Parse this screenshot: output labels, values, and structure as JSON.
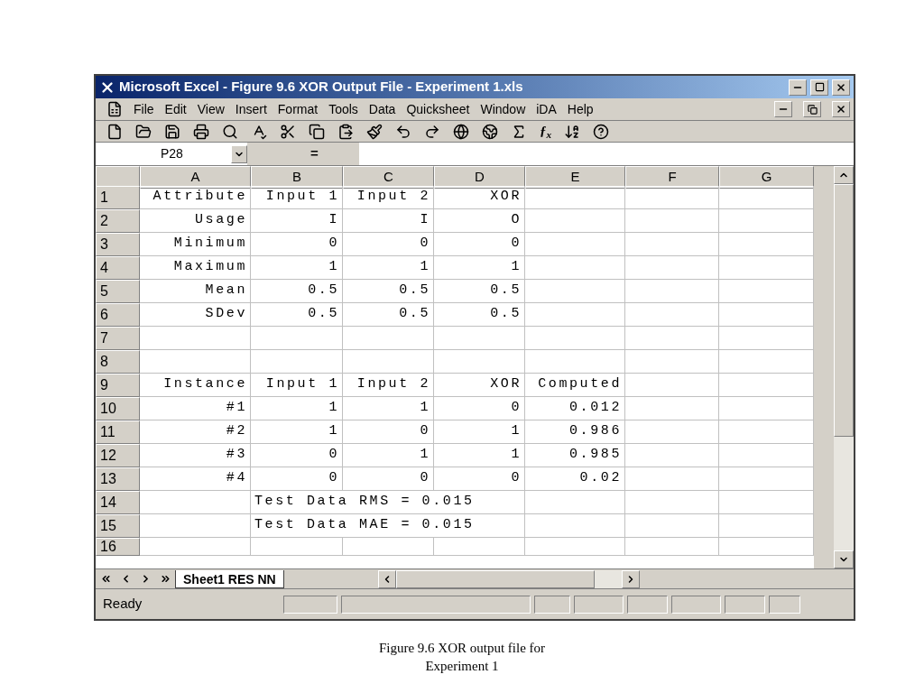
{
  "window": {
    "title": "Microsoft Excel - Figure 9.6 XOR Output File - Experiment 1.xls"
  },
  "menu": [
    "File",
    "Edit",
    "View",
    "Insert",
    "Format",
    "Tools",
    "Data",
    "Quicksheet",
    "Window",
    "iDA",
    "Help"
  ],
  "toolbar": {
    "function_label": "ƒ$_{x}$"
  },
  "formula_bar": {
    "name_box": "P28",
    "equals": "="
  },
  "columns": [
    "A",
    "B",
    "C",
    "D",
    "E",
    "F",
    "G"
  ],
  "rows": [
    {
      "number": "1",
      "kind": "data",
      "cells": [
        "Attribute",
        "Input 1",
        "Input 2",
        "XOR"
      ]
    },
    {
      "number": "2",
      "kind": "data",
      "cells": [
        "Usage",
        "I",
        "I",
        "O"
      ]
    },
    {
      "number": "3",
      "kind": "data",
      "cells": [
        "Minimum",
        "0",
        "0",
        "0"
      ]
    },
    {
      "number": "4",
      "kind": "data",
      "cells": [
        "Maximum",
        "1",
        "1",
        "1"
      ]
    },
    {
      "number": "5",
      "kind": "data",
      "cells": [
        "Mean",
        "0.5",
        "0.5",
        "0.5"
      ]
    },
    {
      "number": "6",
      "kind": "data",
      "cells": [
        "SDev",
        "0.5",
        "0.5",
        "0.5"
      ]
    },
    {
      "number": "7",
      "kind": "data",
      "cells": []
    },
    {
      "number": "8",
      "kind": "data",
      "cells": []
    },
    {
      "number": "9",
      "kind": "data",
      "cells": [
        "Instance",
        "Input 1",
        "Input 2",
        "XOR",
        "Computed"
      ]
    },
    {
      "number": "10",
      "kind": "data",
      "cells": [
        "#1",
        "1",
        "1",
        "0",
        "0.012"
      ]
    },
    {
      "number": "11",
      "kind": "data",
      "cells": [
        "#2",
        "1",
        "0",
        "1",
        "0.986"
      ]
    },
    {
      "number": "12",
      "kind": "data",
      "cells": [
        "#3",
        "0",
        "1",
        "1",
        "0.985"
      ]
    },
    {
      "number": "13",
      "kind": "data",
      "cells": [
        "#4",
        "0",
        "0",
        "0",
        "0.02"
      ]
    },
    {
      "number": "14",
      "kind": "note",
      "cells": [
        "",
        "Test Data RMS = 0.015"
      ]
    },
    {
      "number": "15",
      "kind": "note",
      "cells": [
        "",
        "Test Data MAE = 0.015"
      ]
    },
    {
      "number": "16",
      "kind": "partial",
      "cells": []
    }
  ],
  "sheet_tabs": [
    {
      "label": "Sheet1 RES NN",
      "selected": true
    }
  ],
  "status_bar": {
    "text": "Ready"
  },
  "caption": [
    "Figure 9.6 XOR output file for",
    "Experiment 1"
  ]
}
